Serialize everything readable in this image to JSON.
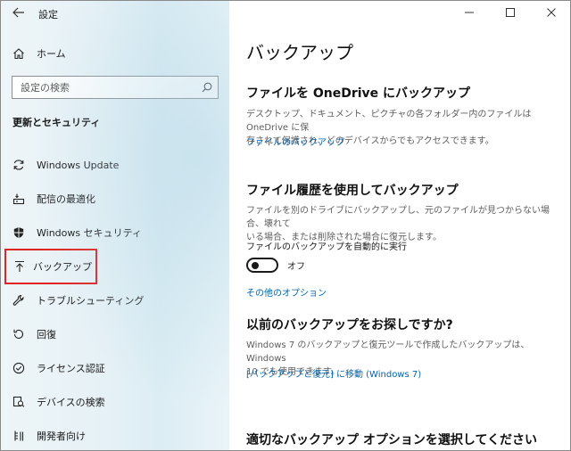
{
  "window": {
    "title": "設定",
    "minimize_glyph": "—",
    "maximize_glyph": "☐",
    "close_glyph": "✕"
  },
  "sidebar": {
    "home_label": "ホーム",
    "search_placeholder": "設定の検索",
    "section_heading": "更新とセキュリティ",
    "items": [
      {
        "label": "Windows Update",
        "icon": "refresh-icon"
      },
      {
        "label": "配信の最適化",
        "icon": "delivery-optimization-icon"
      },
      {
        "label": "Windows セキュリティ",
        "icon": "shield-icon"
      },
      {
        "label": "バックアップ",
        "icon": "backup-arrow-icon"
      },
      {
        "label": "トラブルシューティング",
        "icon": "wrench-icon"
      },
      {
        "label": "回復",
        "icon": "recovery-icon"
      },
      {
        "label": "ライセンス認証",
        "icon": "check-circle-icon"
      },
      {
        "label": "デバイスの検索",
        "icon": "find-device-icon"
      },
      {
        "label": "開発者向け",
        "icon": "developer-icon"
      }
    ]
  },
  "main": {
    "page_title": "バックアップ",
    "onedrive": {
      "title": "ファイルを OneDrive にバックアップ",
      "desc_line1": "デスクトップ、ドキュメント、ピクチャの各フォルダー内のファイルは OneDrive に保",
      "desc_line2": "存されて保護され、どのデバイスからでもアクセスできます。",
      "link": "ファイルのバックアップ"
    },
    "file_history": {
      "title": "ファイル履歴を使用してバックアップ",
      "desc_line1": "ファイルを別のドライブにバックアップし、元のファイルが見つからない場合、壊れて",
      "desc_line2": "いる場合、または削除された場合に復元します。",
      "auto_backup_label": "ファイルのバックアップを自動的に実行",
      "toggle_state": "オフ",
      "more_options_link": "その他のオプション"
    },
    "older_backup": {
      "title": "以前のバックアップをお探しですか?",
      "desc_line1": "Windows 7 のバックアップと復元ツールで作成したバックアップは、Windows",
      "desc_line2": "10 でも使用できます。",
      "link": "[バックアップと復元] に移動 (Windows 7)"
    },
    "choose_option_title": "適切なバックアップ オプションを選択してください"
  }
}
